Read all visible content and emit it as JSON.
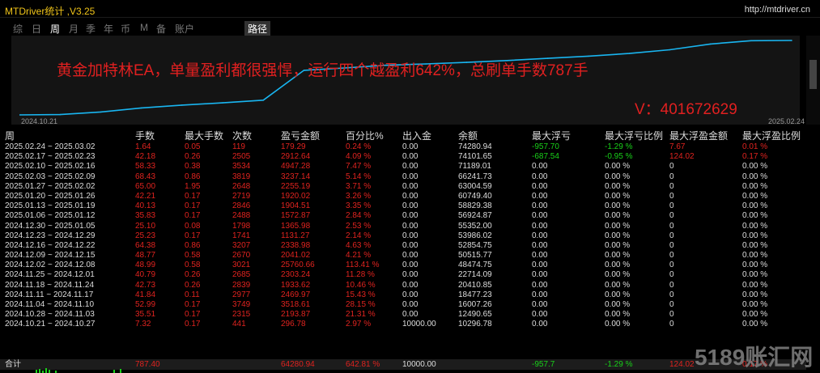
{
  "window": {
    "title": "MTDriver统计 ,V3.25",
    "url": "http://mtdriver.cn"
  },
  "tabs": [
    {
      "label": "综",
      "active": false
    },
    {
      "label": "日",
      "active": false
    },
    {
      "label": "周",
      "active": true
    },
    {
      "label": "月",
      "active": false
    },
    {
      "label": "季",
      "active": false
    },
    {
      "label": "年",
      "active": false
    },
    {
      "label": "币",
      "active": false
    },
    {
      "label": "M",
      "active": false
    },
    {
      "label": "备",
      "active": false
    },
    {
      "label": "账户",
      "active": false
    },
    {
      "label": "路径",
      "active": false
    }
  ],
  "chart": {
    "headline": "黄金加特林EA，单量盈利都很强悍，运行四个越盈利642%，总刷单手数787手",
    "vlabel": "V：401672629",
    "start_date": "2024.10.21",
    "end_date": "2025.02.24",
    "line_color": "#19b5f0"
  },
  "table": {
    "headers": [
      "周",
      "手数",
      "最大手数",
      "次数",
      "盈亏金额",
      "百分比%",
      "出入金",
      "余额",
      "最大浮亏",
      "最大浮亏比例",
      "最大浮盈金额",
      "最大浮盈比例"
    ],
    "rows": [
      [
        "2025.02.24 ~ 2025.03.02",
        "1.64",
        "0.05",
        "119",
        "179.29",
        "0.24 %",
        "0.00",
        "74280.94",
        "-957.70",
        "-1.29 %",
        "7.67",
        "0.01 %"
      ],
      [
        "2025.02.17 ~ 2025.02.23",
        "42.18",
        "0.26",
        "2505",
        "2912.64",
        "4.09 %",
        "0.00",
        "74101.65",
        "-687.54",
        "-0.95 %",
        "124.02",
        "0.17 %"
      ],
      [
        "2025.02.10 ~ 2025.02.16",
        "58.33",
        "0.38",
        "3534",
        "4947.28",
        "7.47 %",
        "0.00",
        "71189.01",
        "0.00",
        "0.00 %",
        "0",
        "0.00 %"
      ],
      [
        "2025.02.03 ~ 2025.02.09",
        "68.43",
        "0.86",
        "3819",
        "3237.14",
        "5.14 %",
        "0.00",
        "66241.73",
        "0.00",
        "0.00 %",
        "0",
        "0.00 %"
      ],
      [
        "2025.01.27 ~ 2025.02.02",
        "65.00",
        "1.95",
        "2648",
        "2255.19",
        "3.71 %",
        "0.00",
        "63004.59",
        "0.00",
        "0.00 %",
        "0",
        "0.00 %"
      ],
      [
        "2025.01.20 ~ 2025.01.26",
        "42.21",
        "0.17",
        "2719",
        "1920.02",
        "3.26 %",
        "0.00",
        "60749.40",
        "0.00",
        "0.00 %",
        "0",
        "0.00 %"
      ],
      [
        "2025.01.13 ~ 2025.01.19",
        "40.13",
        "0.17",
        "2846",
        "1904.51",
        "3.35 %",
        "0.00",
        "58829.38",
        "0.00",
        "0.00 %",
        "0",
        "0.00 %"
      ],
      [
        "2025.01.06 ~ 2025.01.12",
        "35.83",
        "0.17",
        "2488",
        "1572.87",
        "2.84 %",
        "0.00",
        "56924.87",
        "0.00",
        "0.00 %",
        "0",
        "0.00 %"
      ],
      [
        "2024.12.30 ~ 2025.01.05",
        "25.10",
        "0.08",
        "1798",
        "1365.98",
        "2.53 %",
        "0.00",
        "55352.00",
        "0.00",
        "0.00 %",
        "0",
        "0.00 %"
      ],
      [
        "2024.12.23 ~ 2024.12.29",
        "25.23",
        "0.17",
        "1741",
        "1131.27",
        "2.14 %",
        "0.00",
        "53986.02",
        "0.00",
        "0.00 %",
        "0",
        "0.00 %"
      ],
      [
        "2024.12.16 ~ 2024.12.22",
        "64.38",
        "0.86",
        "3207",
        "2338.98",
        "4.63 %",
        "0.00",
        "52854.75",
        "0.00",
        "0.00 %",
        "0",
        "0.00 %"
      ],
      [
        "2024.12.09 ~ 2024.12.15",
        "48.77",
        "0.58",
        "2670",
        "2041.02",
        "4.21 %",
        "0.00",
        "50515.77",
        "0.00",
        "0.00 %",
        "0",
        "0.00 %"
      ],
      [
        "2024.12.02 ~ 2024.12.08",
        "48.99",
        "0.58",
        "3021",
        "25760.66",
        "113.41 %",
        "0.00",
        "48474.75",
        "0.00",
        "0.00 %",
        "0",
        "0.00 %"
      ],
      [
        "2024.11.25 ~ 2024.12.01",
        "40.79",
        "0.26",
        "2685",
        "2303.24",
        "11.28 %",
        "0.00",
        "22714.09",
        "0.00",
        "0.00 %",
        "0",
        "0.00 %"
      ],
      [
        "2024.11.18 ~ 2024.11.24",
        "42.73",
        "0.26",
        "2839",
        "1933.62",
        "10.46 %",
        "0.00",
        "20410.85",
        "0.00",
        "0.00 %",
        "0",
        "0.00 %"
      ],
      [
        "2024.11.11 ~ 2024.11.17",
        "41.84",
        "0.11",
        "2977",
        "2469.97",
        "15.43 %",
        "0.00",
        "18477.23",
        "0.00",
        "0.00 %",
        "0",
        "0.00 %"
      ],
      [
        "2024.11.04 ~ 2024.11.10",
        "52.99",
        "0.17",
        "3749",
        "3518.61",
        "28.15 %",
        "0.00",
        "16007.26",
        "0.00",
        "0.00 %",
        "0",
        "0.00 %"
      ],
      [
        "2024.10.28 ~ 2024.11.03",
        "35.51",
        "0.17",
        "2315",
        "2193.87",
        "21.31 %",
        "0.00",
        "12490.65",
        "0.00",
        "0.00 %",
        "0",
        "0.00 %"
      ],
      [
        "2024.10.21 ~ 2024.10.27",
        "7.32",
        "0.17",
        "441",
        "296.78",
        "2.97 %",
        "10000.00",
        "10296.78",
        "0.00",
        "0.00 %",
        "0",
        "0.00 %"
      ]
    ],
    "total": [
      "合计",
      "787.40",
      "",
      "",
      "64280.94",
      "642.81 %",
      "10000.00",
      "",
      "-957.7",
      "-1.29 %",
      "124.02",
      "0.17 %"
    ]
  },
  "chart_data": {
    "type": "line",
    "x": [
      "2024.10.21",
      "2024.10.28",
      "2024.11.04",
      "2024.11.11",
      "2024.11.18",
      "2024.11.25",
      "2024.12.02",
      "2024.12.09",
      "2024.12.16",
      "2024.12.23",
      "2024.12.30",
      "2025.01.06",
      "2025.01.13",
      "2025.01.20",
      "2025.01.27",
      "2025.02.03",
      "2025.02.10",
      "2025.02.17",
      "2025.02.24"
    ],
    "series": [
      {
        "values": [
          10296.78,
          12490.65,
          16007.26,
          18477.23,
          20410.85,
          22714.09,
          48474.75,
          50515.77,
          52854.75,
          53986.02,
          55352.0,
          56924.87,
          58829.38,
          60749.4,
          63004.59,
          66241.73,
          71189.01,
          74101.65,
          74280.94
        ]
      }
    ],
    "title": "",
    "xlabel": "",
    "ylabel": ""
  },
  "watermark": "5189账汇网"
}
